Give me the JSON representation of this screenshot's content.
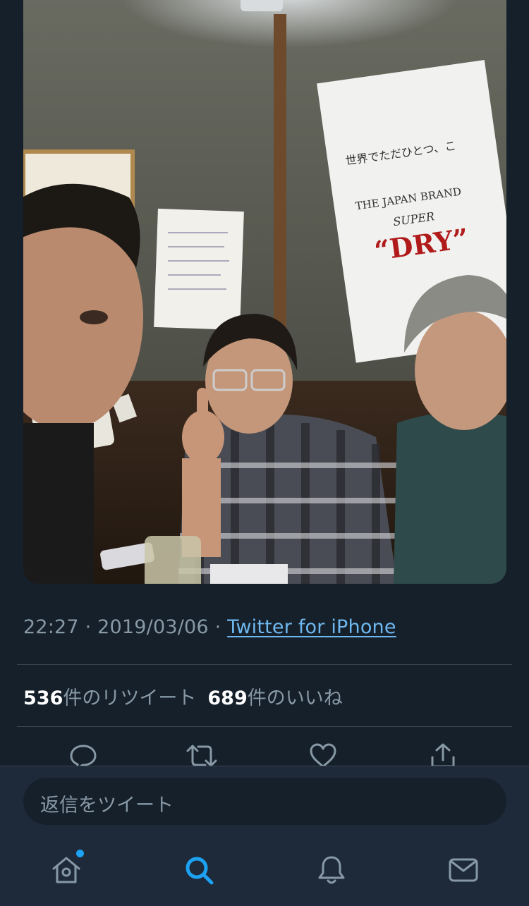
{
  "tweet": {
    "photo_alt": "photo-of-three-men-at-izakaya",
    "poster_text": {
      "line1": "世界でただひとつ、こ",
      "line2": "THE JAPAN BRAND",
      "line3": "SUPER",
      "line4": "“DRY”"
    },
    "time": "22:27",
    "date": "2019/03/06",
    "separator": " · ",
    "source": "Twitter for iPhone"
  },
  "stats": {
    "retweet_count": "536",
    "retweet_label": "件のリツイート",
    "like_count": "689",
    "like_label": "件のいいね"
  },
  "actions": {
    "icons": [
      "reply-icon",
      "retweet-icon",
      "like-icon",
      "share-icon"
    ]
  },
  "reply": {
    "placeholder": "返信をツイート"
  },
  "tabbar": {
    "icons": [
      "home-icon",
      "search-icon",
      "notifications-icon",
      "messages-icon"
    ],
    "active_color": "#1da1f2",
    "inactive_color": "#8899a6"
  },
  "colors": {
    "background": "#15202b",
    "text_secondary": "#8899a6",
    "accent": "#1da1f2",
    "divider": "#38444d"
  }
}
